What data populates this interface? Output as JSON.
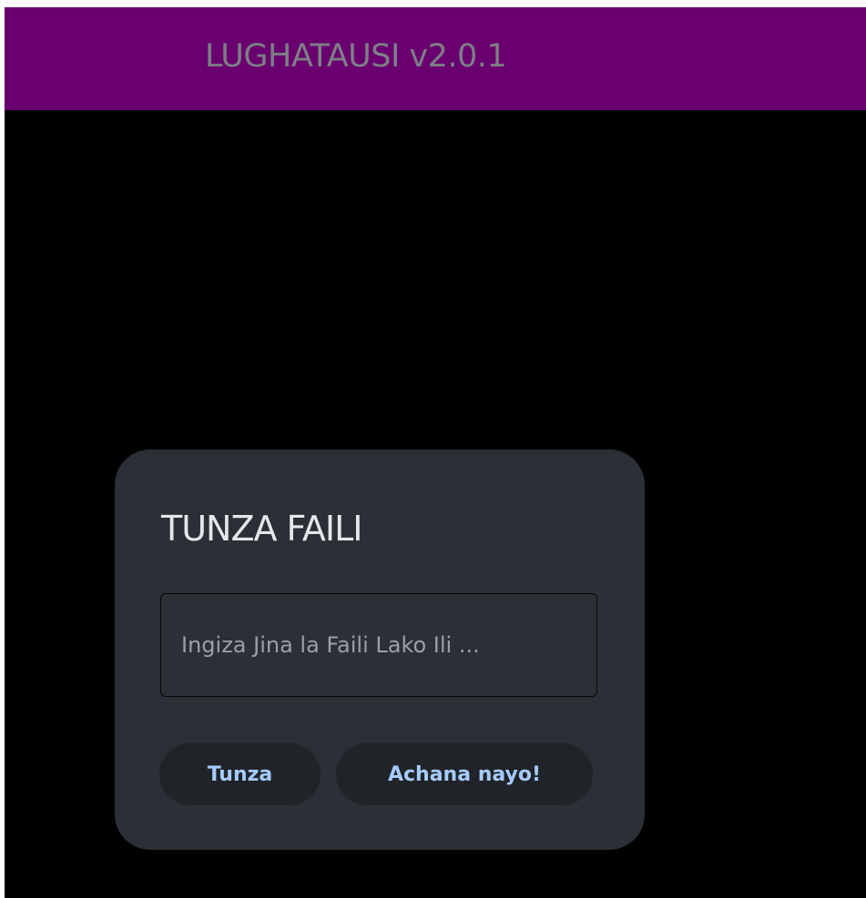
{
  "header": {
    "title": "LUGHATAUSI v2.0.1"
  },
  "dialog": {
    "title": "TUNZA FAILI",
    "filename_input": {
      "value": "",
      "placeholder": "Ingiza Jina la Faili Lako Ili ..."
    },
    "buttons": {
      "save_label": "Tunza",
      "cancel_label": "Achana nayo!"
    }
  },
  "colors": {
    "header_background": "#6a006f",
    "app_background": "#000000",
    "dialog_background": "#2b2f36",
    "button_background": "#202328",
    "button_text": "#a6cbff",
    "header_title_text": "#7d7f86"
  }
}
